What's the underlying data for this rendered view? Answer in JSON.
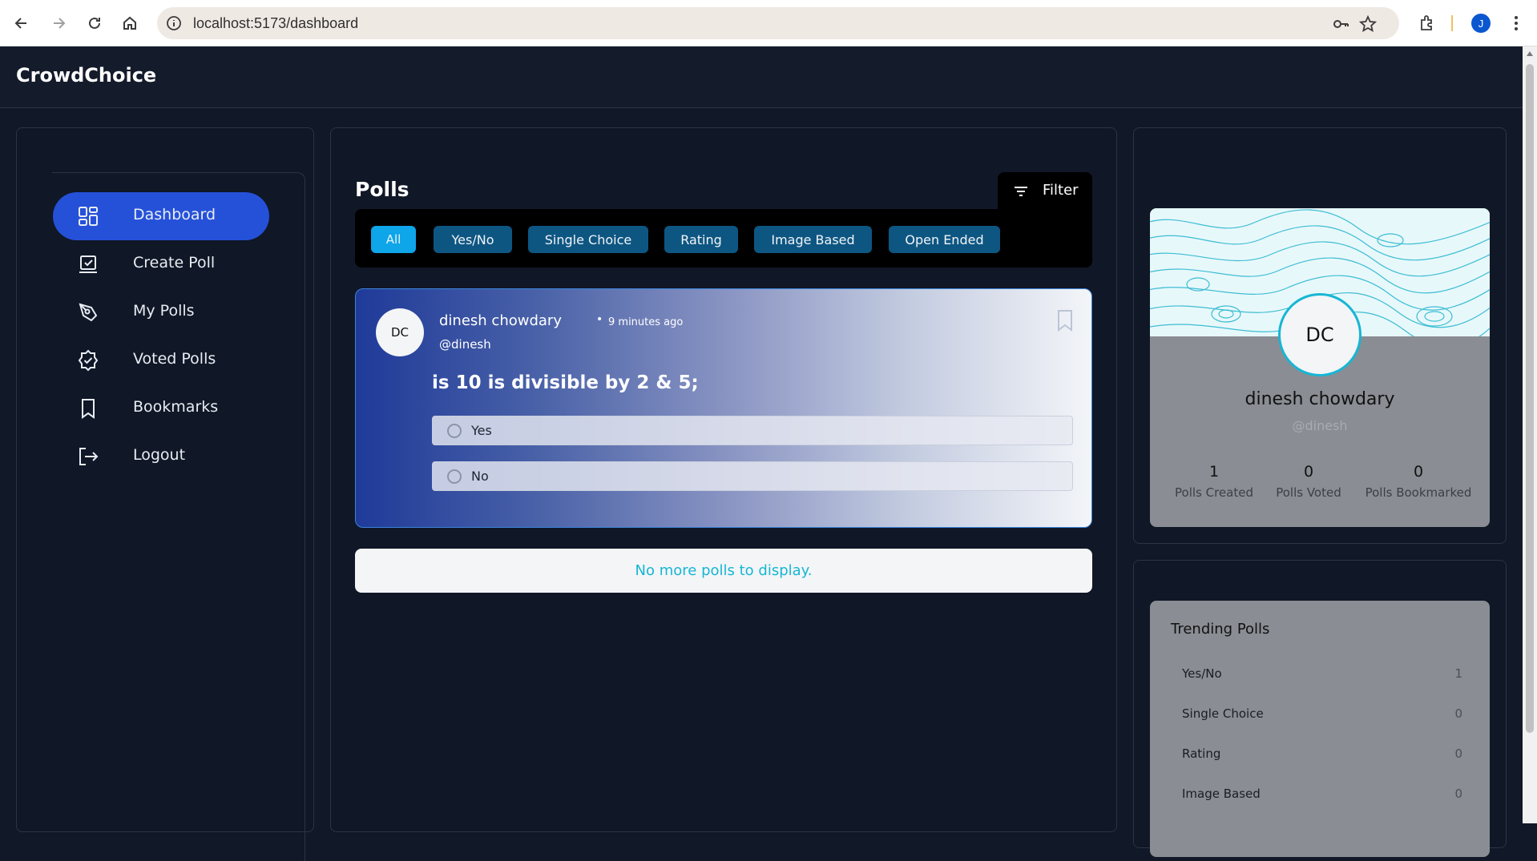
{
  "browser": {
    "url": "localhost:5173/dashboard",
    "profile_initial": "J"
  },
  "app": {
    "brand": "CrowdChoice"
  },
  "sidebar": {
    "items": [
      {
        "label": "Dashboard",
        "icon": "dashboard-icon",
        "active": true
      },
      {
        "label": "Create Poll",
        "icon": "create-poll-icon"
      },
      {
        "label": "My Polls",
        "icon": "pen-icon"
      },
      {
        "label": "Voted Polls",
        "icon": "badge-check-icon"
      },
      {
        "label": "Bookmarks",
        "icon": "bookmark-icon"
      },
      {
        "label": "Logout",
        "icon": "logout-icon"
      }
    ]
  },
  "main": {
    "title": "Polls",
    "filter_label": "Filter",
    "chips": [
      "All",
      "Yes/No",
      "Single Choice",
      "Rating",
      "Image Based",
      "Open Ended"
    ],
    "active_chip": "All",
    "poll": {
      "avatar_initials": "DC",
      "author": "dinesh chowdary",
      "dot": "•",
      "time_ago": "9 minutes ago",
      "handle": "@dinesh",
      "question": "is 10 is divisible by 2 & 5;",
      "options": [
        "Yes",
        "No"
      ]
    },
    "no_more": "No more polls to display."
  },
  "profile": {
    "initials": "DC",
    "name": "dinesh chowdary",
    "handle": "@dinesh",
    "stats": [
      {
        "value": "1",
        "label": "Polls Created"
      },
      {
        "value": "0",
        "label": "Polls Voted"
      },
      {
        "value": "0",
        "label": "Polls Bookmarked"
      }
    ]
  },
  "trending": {
    "title": "Trending Polls",
    "rows": [
      {
        "label": "Yes/No",
        "count": "1"
      },
      {
        "label": "Single Choice",
        "count": "0"
      },
      {
        "label": "Rating",
        "count": "0"
      },
      {
        "label": "Image Based",
        "count": "0"
      }
    ]
  },
  "colors": {
    "accent_blue": "#2551d9",
    "chip_bg": "#0e5682",
    "chip_active": "#0ea5e9",
    "cyan_text": "#17b6d4",
    "page_bg": "#111827"
  }
}
